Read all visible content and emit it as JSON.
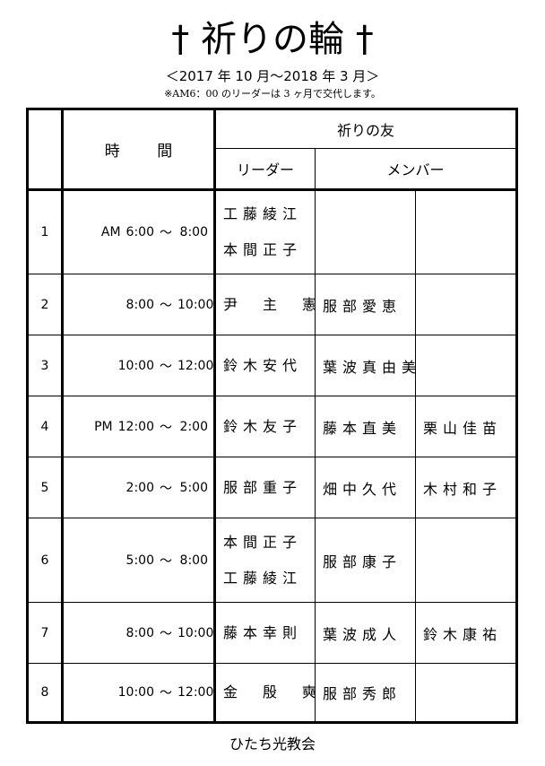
{
  "header": {
    "title": "† 祈りの輪 †",
    "period": "＜2017 年 10 月～2018 年 3 月＞",
    "note": "※AM6：00 のリーダーは 3 ヶ月で交代します。"
  },
  "table": {
    "time_header": "時 間",
    "group_header": "祈りの友",
    "leader_header": "リーダー",
    "member_header": "メンバー",
    "tilde": "～",
    "rows": [
      {
        "no": "1",
        "ampm": "AM",
        "start": "6:00",
        "end": "8:00",
        "leader": [
          "工藤綾江",
          "本間正子"
        ],
        "member1": "",
        "member2": ""
      },
      {
        "no": "2",
        "ampm": "",
        "start": "8:00",
        "end": "10:00",
        "leader": [
          "尹　主　憲"
        ],
        "member1": "服部愛恵",
        "member2": ""
      },
      {
        "no": "3",
        "ampm": "",
        "start": "10:00",
        "end": "12:00",
        "leader": [
          "鈴木安代"
        ],
        "member1": "葉波真由美",
        "member2": ""
      },
      {
        "no": "4",
        "ampm": "PM",
        "start": "12:00",
        "end": "2:00",
        "leader": [
          "鈴木友子"
        ],
        "member1": "藤本直美",
        "member2": "栗山佳苗"
      },
      {
        "no": "5",
        "ampm": "",
        "start": "2:00",
        "end": "5:00",
        "leader": [
          "服部重子"
        ],
        "member1": "畑中久代",
        "member2": "木村和子"
      },
      {
        "no": "6",
        "ampm": "",
        "start": "5:00",
        "end": "8:00",
        "leader": [
          "本間正子",
          "工藤綾江"
        ],
        "member1": "服部康子",
        "member2": ""
      },
      {
        "no": "7",
        "ampm": "",
        "start": "8:00",
        "end": "10:00",
        "leader": [
          "藤本幸則"
        ],
        "member1": "葉波成人",
        "member2": "鈴木康祐"
      },
      {
        "no": "8",
        "ampm": "",
        "start": "10:00",
        "end": "12:00",
        "leader": [
          "金　殷　奭"
        ],
        "member1": "服部秀郎",
        "member2": ""
      }
    ]
  },
  "footer": {
    "org": "ひたち光教会"
  }
}
